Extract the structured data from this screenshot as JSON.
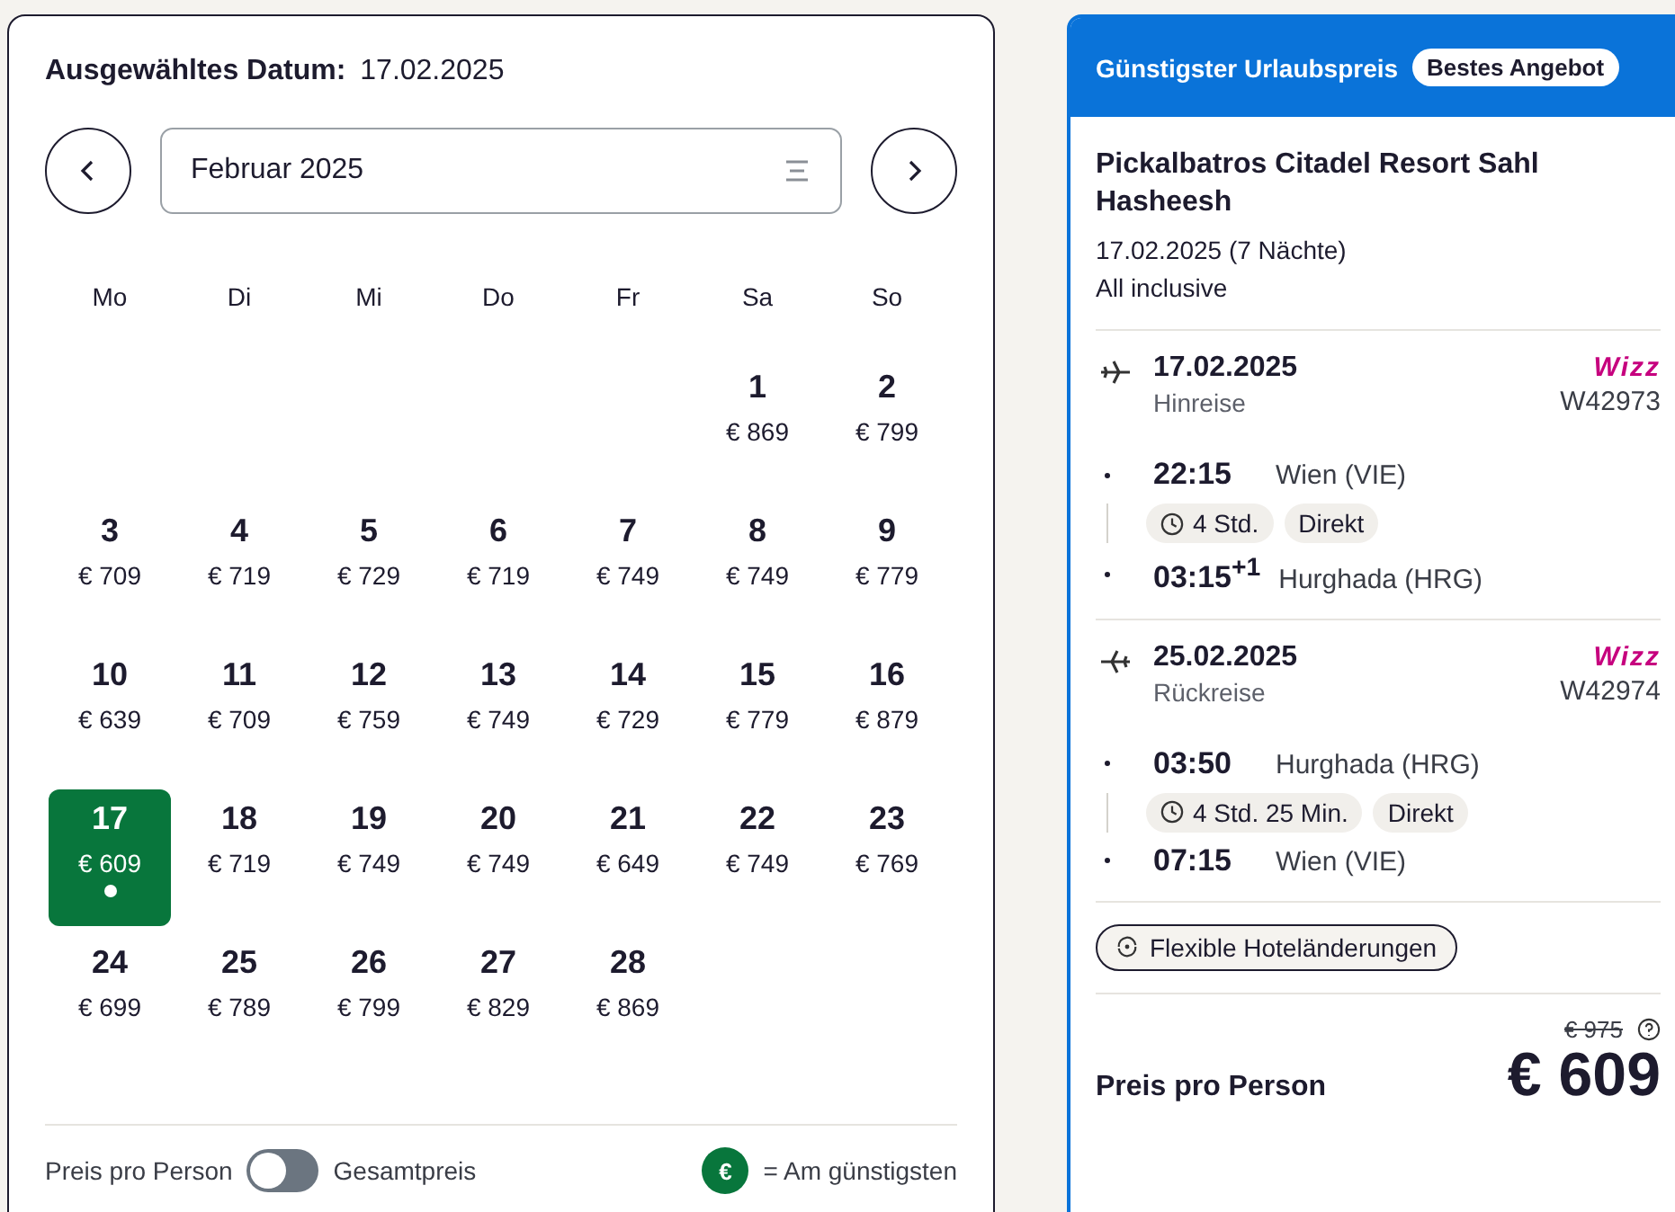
{
  "calendar": {
    "selected_label": "Ausgewähltes Datum:",
    "selected_date": "17.02.2025",
    "month": "Februar 2025",
    "weekdays": [
      "Mo",
      "Di",
      "Mi",
      "Do",
      "Fr",
      "Sa",
      "So"
    ],
    "weeks": [
      [
        {
          "day": "1",
          "price": "€ 869",
          "selected": false
        },
        {
          "day": "2",
          "price": "€ 799",
          "selected": false
        }
      ],
      [
        {
          "day": "3",
          "price": "€ 709",
          "selected": false
        },
        {
          "day": "4",
          "price": "€ 719",
          "selected": false
        },
        {
          "day": "5",
          "price": "€ 729",
          "selected": false
        },
        {
          "day": "6",
          "price": "€ 719",
          "selected": false
        },
        {
          "day": "7",
          "price": "€ 749",
          "selected": false
        },
        {
          "day": "8",
          "price": "€ 749",
          "selected": false
        },
        {
          "day": "9",
          "price": "€ 779",
          "selected": false
        }
      ],
      [
        {
          "day": "10",
          "price": "€ 639",
          "selected": false
        },
        {
          "day": "11",
          "price": "€ 709",
          "selected": false
        },
        {
          "day": "12",
          "price": "€ 759",
          "selected": false
        },
        {
          "day": "13",
          "price": "€ 749",
          "selected": false
        },
        {
          "day": "14",
          "price": "€ 729",
          "selected": false
        },
        {
          "day": "15",
          "price": "€ 779",
          "selected": false
        },
        {
          "day": "16",
          "price": "€ 879",
          "selected": false
        }
      ],
      [
        {
          "day": "17",
          "price": "€ 609",
          "selected": true
        },
        {
          "day": "18",
          "price": "€ 719",
          "selected": false
        },
        {
          "day": "19",
          "price": "€ 749",
          "selected": false
        },
        {
          "day": "20",
          "price": "€ 749",
          "selected": false
        },
        {
          "day": "21",
          "price": "€ 649",
          "selected": false
        },
        {
          "day": "22",
          "price": "€ 749",
          "selected": false
        },
        {
          "day": "23",
          "price": "€ 769",
          "selected": false
        }
      ],
      [
        {
          "day": "24",
          "price": "€ 699",
          "selected": false
        },
        {
          "day": "25",
          "price": "€ 789",
          "selected": false
        },
        {
          "day": "26",
          "price": "€ 799",
          "selected": false
        },
        {
          "day": "27",
          "price": "€ 829",
          "selected": false
        },
        {
          "day": "28",
          "price": "€ 869",
          "selected": false
        }
      ]
    ]
  },
  "footer": {
    "left_label": "Preis pro Person",
    "toggle_on": false,
    "right_label": "Gesamtpreis",
    "legend_badge": "€",
    "legend_text": "= Am günstigsten"
  },
  "offer": {
    "header_title": "Günstigster Urlaubspreis",
    "badge": "Bestes Angebot",
    "hotel": "Pickalbatros Citadel Resort Sahl Hasheesh",
    "dates": "17.02.2025 (7 Nächte)",
    "board": "All inclusive",
    "flights": [
      {
        "kind": "outbound",
        "date": "17.02.2025",
        "direction": "Hinreise",
        "airline": "Wizz",
        "flight_no": "W42973",
        "duration": "4 Std.",
        "stops": "Direkt",
        "legs": [
          {
            "time": "22:15",
            "place": "Wien (VIE)"
          },
          {
            "time": "03:15$^{+1}$",
            "place": "Hurghada (HRG)"
          }
        ]
      },
      {
        "kind": "return",
        "date": "25.02.2025",
        "direction": "Rückreise",
        "airline": "Wizz",
        "flight_no": "W42974",
        "duration": "4 Std. 25 Min.",
        "stops": "Direkt",
        "legs": [
          {
            "time": "03:50",
            "place": "Hurghada (HRG)"
          },
          {
            "time": "07:15",
            "place": "Wien (VIE)"
          }
        ]
      }
    ],
    "feature": "Flexible Hoteländerungen",
    "old_price": "€ 975",
    "price_label": "Preis pro Person",
    "price": "€ 609"
  }
}
